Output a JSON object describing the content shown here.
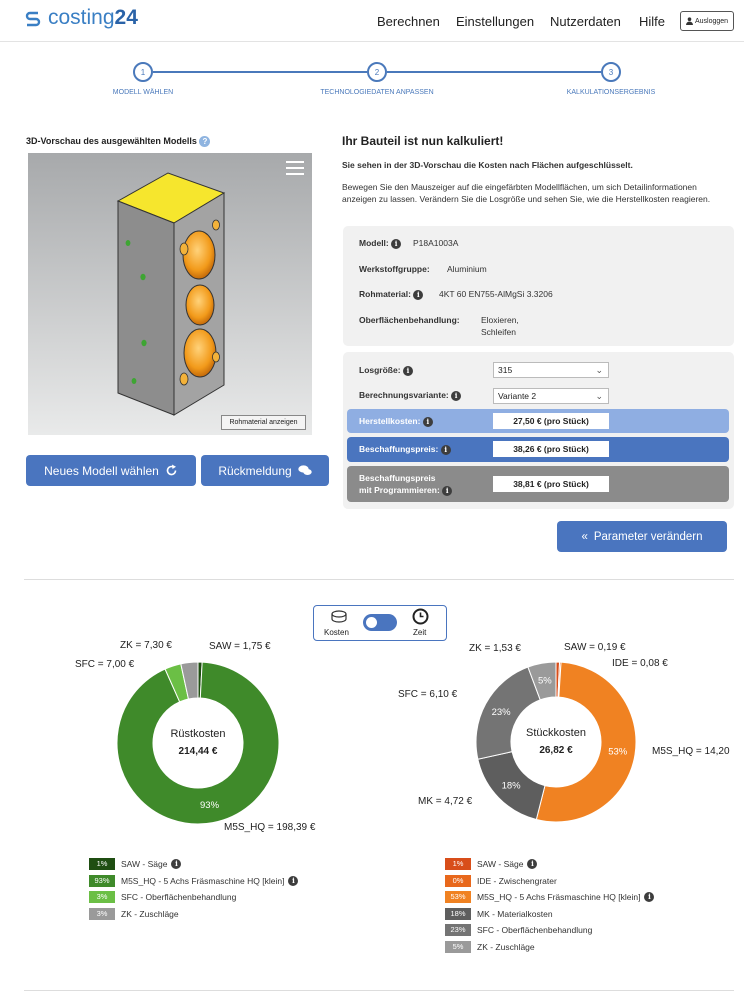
{
  "header": {
    "logo_a": "costing",
    "logo_b": "24",
    "nav": [
      "Berechnen",
      "Einstellungen",
      "Nutzerdaten",
      "Hilfe"
    ],
    "logout": "Ausloggen"
  },
  "steps": [
    {
      "num": "1",
      "label": "MODELL WÄHLEN"
    },
    {
      "num": "2",
      "label": "TECHNOLOGIEDATEN ANPASSEN"
    },
    {
      "num": "3",
      "label": "KALKULATIONSERGEBNIS"
    }
  ],
  "left": {
    "title": "3D-Vorschau des ausgewählten Modells",
    "raw_btn": "Rohmaterial anzeigen",
    "btn_new": "Neues Modell wählen",
    "btn_feedback": "Rückmeldung"
  },
  "right": {
    "heading": "Ihr Bauteil ist nun kalkuliert!",
    "sub": "Sie sehen in der 3D-Vorschau die Kosten nach Flächen aufgeschlüsselt.",
    "desc": "Bewegen Sie den Mauszeiger auf die eingefärbten Modellflächen, um sich Detailinformationen anzeigen zu lassen. Verändern Sie die Losgröße und sehen Sie, wie die Herstellkosten reagieren."
  },
  "model": {
    "modell_label": "Modell:",
    "modell_value": "P18A1003A",
    "werkstoff_label": "Werkstoffgruppe:",
    "werkstoff_value": "Aluminium",
    "roh_label": "Rohmaterial:",
    "roh_value": "4KT 60 EN755-AlMgSi 3.3206",
    "ober_label": "Oberflächenbehandlung:",
    "ober_value1": "Eloxieren,",
    "ober_value2": "Schleifen"
  },
  "calc": {
    "los_label": "Losgröße:",
    "los_value": "315",
    "var_label": "Berechnungsvariante:",
    "var_value": "Variante 2",
    "herst_label": "Herstellkosten:",
    "herst_value": "27,50 € (pro Stück)",
    "beschaff_label": "Beschaffungspreis:",
    "beschaff_value": "38,26 € (pro Stück)",
    "prog_label1": "Beschaffungspreis",
    "prog_label2": "mit Programmieren:",
    "prog_value": "38,81 € (pro Stück)",
    "param_btn": "Parameter verändern"
  },
  "toggle": {
    "left": "Kosten",
    "right": "Zeit"
  },
  "colors": {
    "accent": "#4a75bf",
    "green_dark": "#2f6b1a",
    "green_main": "#3f8a2a",
    "green_light": "#6bbf45",
    "gray": "#8a8a8a",
    "orange": "#f08020",
    "orange_dark": "#d84e1a",
    "gray_dark": "#666"
  },
  "chart_data": [
    {
      "type": "pie",
      "title": "Rüstkosten",
      "total": "214,44 €",
      "slices": [
        {
          "key": "SAW",
          "name": "SAW - Säge",
          "value": 1.75,
          "pct": "1%",
          "label": "SAW = 1,75 €",
          "color": "#1f4e12"
        },
        {
          "key": "M5S_HQ",
          "name": "M5S_HQ - 5 Achs Fräsmaschine HQ [klein]",
          "value": 198.39,
          "pct": "93%",
          "label": "M5S_HQ = 198,39 €",
          "color": "#3f8a2a"
        },
        {
          "key": "SFC",
          "name": "SFC - Oberflächenbehandlung",
          "value": 7.0,
          "pct": "3%",
          "label": "SFC = 7,00 €",
          "color": "#6bbf45"
        },
        {
          "key": "ZK",
          "name": "ZK - Zuschläge",
          "value": 7.3,
          "pct": "3%",
          "label": "ZK = 7,30 €",
          "color": "#9a9a9a"
        }
      ]
    },
    {
      "type": "pie",
      "title": "Stückkosten",
      "total": "26,82 €",
      "slices": [
        {
          "key": "SAW",
          "name": "SAW - Säge",
          "value": 0.19,
          "pct": "1%",
          "label": "SAW = 0,19 €",
          "color": "#d84e1a"
        },
        {
          "key": "IDE",
          "name": "IDE - Zwischengrater",
          "value": 0.08,
          "pct": "0%",
          "label": "IDE = 0,08 €",
          "color": "#e8681c"
        },
        {
          "key": "M5S_HQ",
          "name": "M5S_HQ - 5 Achs Fräsmaschine HQ [klein]",
          "value": 14.2,
          "pct": "53%",
          "label": "M5S_HQ = 14,20",
          "color": "#f08222"
        },
        {
          "key": "MK",
          "name": "MK - Materialkosten",
          "value": 4.72,
          "pct": "18%",
          "label": "MK = 4,72 €",
          "color": "#5e5e5e"
        },
        {
          "key": "SFC",
          "name": "SFC - Oberflächenbehandlung",
          "value": 6.1,
          "pct": "23%",
          "label": "SFC = 6,10 €",
          "color": "#747474"
        },
        {
          "key": "ZK",
          "name": "ZK - Zuschläge",
          "value": 1.53,
          "pct": "5%",
          "label": "ZK = 1,53 €",
          "color": "#9a9a9a"
        }
      ]
    }
  ]
}
